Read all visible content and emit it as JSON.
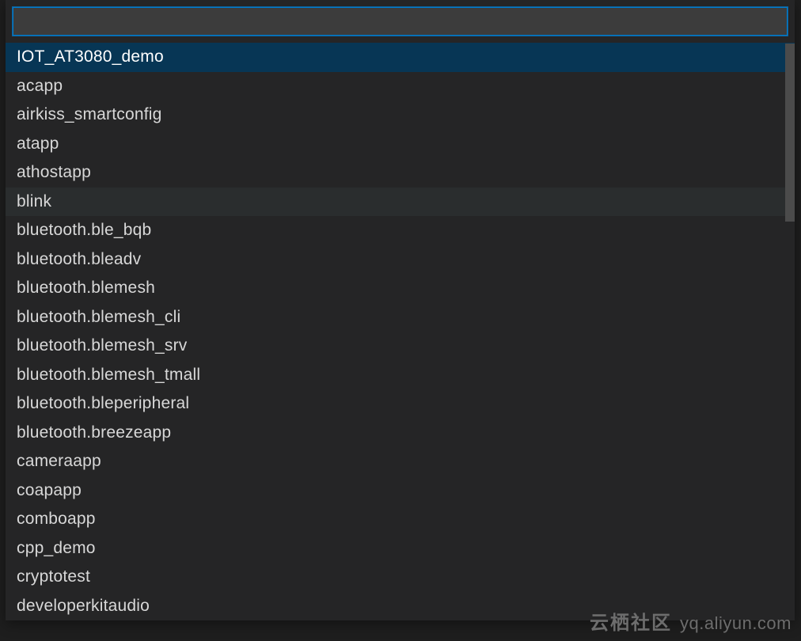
{
  "filter": {
    "value": "",
    "placeholder": ""
  },
  "watermark": {
    "text_cn": "云栖社区",
    "url": "yq.aliyun.com"
  },
  "items": [
    {
      "label": "IOT_AT3080_demo",
      "selected": true,
      "hover": false
    },
    {
      "label": "acapp",
      "selected": false,
      "hover": false
    },
    {
      "label": "airkiss_smartconfig",
      "selected": false,
      "hover": false
    },
    {
      "label": "atapp",
      "selected": false,
      "hover": false
    },
    {
      "label": "athostapp",
      "selected": false,
      "hover": false
    },
    {
      "label": "blink",
      "selected": false,
      "hover": true
    },
    {
      "label": "bluetooth.ble_bqb",
      "selected": false,
      "hover": false
    },
    {
      "label": "bluetooth.bleadv",
      "selected": false,
      "hover": false
    },
    {
      "label": "bluetooth.blemesh",
      "selected": false,
      "hover": false
    },
    {
      "label": "bluetooth.blemesh_cli",
      "selected": false,
      "hover": false
    },
    {
      "label": "bluetooth.blemesh_srv",
      "selected": false,
      "hover": false
    },
    {
      "label": "bluetooth.blemesh_tmall",
      "selected": false,
      "hover": false
    },
    {
      "label": "bluetooth.bleperipheral",
      "selected": false,
      "hover": false
    },
    {
      "label": "bluetooth.breezeapp",
      "selected": false,
      "hover": false
    },
    {
      "label": "cameraapp",
      "selected": false,
      "hover": false
    },
    {
      "label": "coapapp",
      "selected": false,
      "hover": false
    },
    {
      "label": "comboapp",
      "selected": false,
      "hover": false
    },
    {
      "label": "cpp_demo",
      "selected": false,
      "hover": false
    },
    {
      "label": "cryptotest",
      "selected": false,
      "hover": false
    },
    {
      "label": "developerkitaudio",
      "selected": false,
      "hover": false
    }
  ]
}
